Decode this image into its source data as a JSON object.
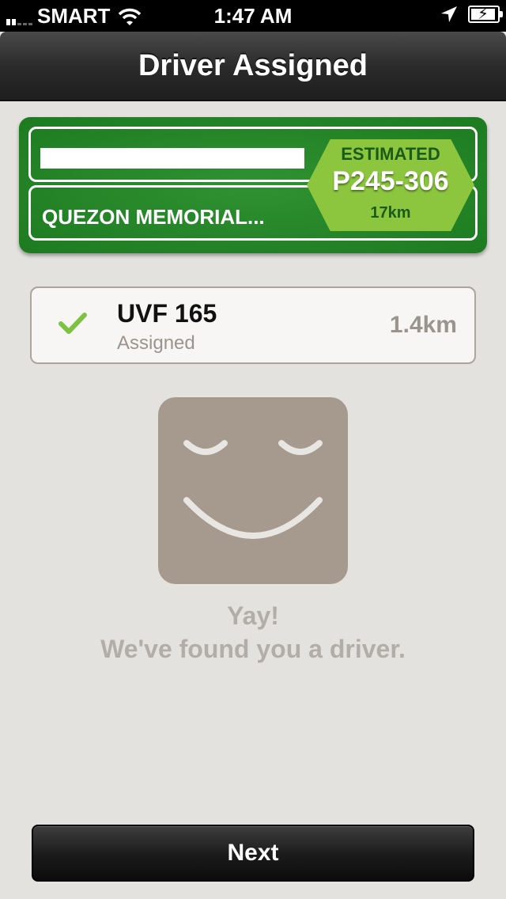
{
  "status_bar": {
    "carrier": "SMART",
    "time": "1:47 AM"
  },
  "nav": {
    "title": "Driver Assigned"
  },
  "route": {
    "destination": "QUEZON MEMORIAL...",
    "estimate_label": "ESTIMATED",
    "fare": "P245-306",
    "distance": "17km"
  },
  "driver": {
    "plate": "UVF 165",
    "status": "Assigned",
    "distance": "1.4km"
  },
  "message": {
    "line1": "Yay!",
    "line2": "We've found you a driver."
  },
  "actions": {
    "next_label": "Next"
  },
  "colors": {
    "card_green": "#24862a",
    "estimate_green": "#8cc63f",
    "check_green": "#7dc242",
    "smiley_bg": "#a69a8f"
  },
  "icons": [
    "signal-icon",
    "wifi-icon",
    "location-arrow-icon",
    "battery-icon",
    "check-icon",
    "smiley-icon"
  ]
}
